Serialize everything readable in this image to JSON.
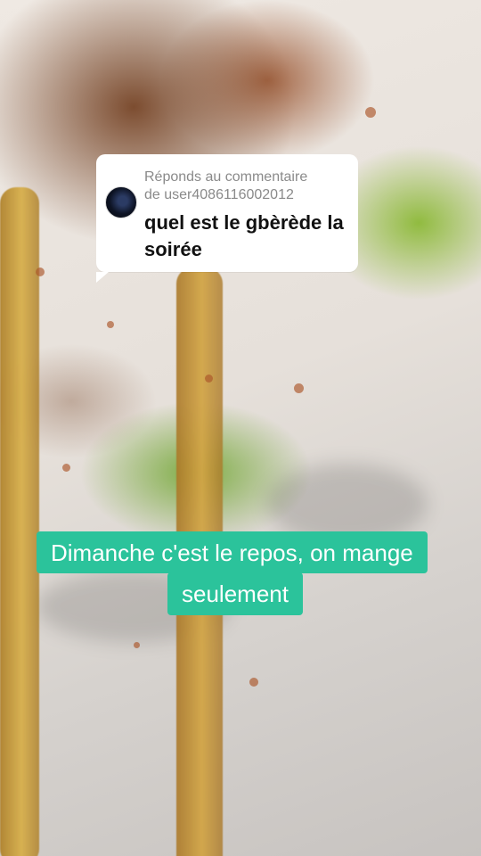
{
  "comment_reply": {
    "header_line1": "Réponds au commentaire",
    "header_line2": "de user4086116002012",
    "text": "quel est le gbèrède la soirée"
  },
  "caption": {
    "line1": "Dimanche c'est le repos, on mange",
    "line2": "seulement"
  },
  "colors": {
    "caption_bg": "#2bc39b",
    "card_bg": "#ffffff"
  },
  "icons": {
    "avatar": "user-avatar"
  }
}
